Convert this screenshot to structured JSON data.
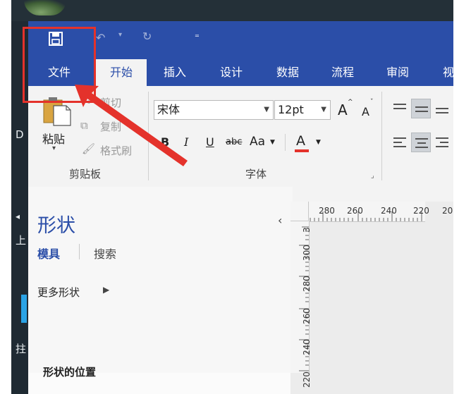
{
  "desktop": {
    "glyphs": [
      "D",
      "上",
      "拄"
    ]
  },
  "quick_access": {
    "save_icon": "save-icon",
    "undo_icon": "undo-icon",
    "redo_icon": "redo-icon",
    "customize_icon": "customize-qat-icon"
  },
  "tabs": [
    {
      "label": "文件"
    },
    {
      "label": "开始"
    },
    {
      "label": "插入"
    },
    {
      "label": "设计"
    },
    {
      "label": "数据"
    },
    {
      "label": "流程"
    },
    {
      "label": "审阅"
    },
    {
      "label": "视"
    }
  ],
  "clipboard": {
    "paste_label": "粘贴",
    "cut_label": "剪切",
    "copy_label": "复制",
    "format_painter_label": "格式刷",
    "group_label": "剪贴板"
  },
  "font": {
    "font_name": "宋体",
    "font_size": "12pt",
    "bold": "B",
    "italic": "I",
    "underline": "U",
    "strikethrough": "abc",
    "change_case": "Aa",
    "font_color": "A",
    "grow": "A",
    "shrink": "A",
    "group_label": "字体"
  },
  "shapes": {
    "title": "形状",
    "tab_stencils": "模具",
    "tab_search": "搜索",
    "more_shapes": "更多形状",
    "shape_location": "形状的位置"
  },
  "ruler": {
    "h_labels": [
      "280",
      "260",
      "240",
      "220",
      "20"
    ],
    "v_labels": [
      "3",
      "300",
      "280",
      "260",
      "240",
      "220"
    ]
  },
  "colors": {
    "title_bar": "#2b4ea8",
    "highlight": "#e4322b",
    "arrow": "#e4322b",
    "font_color_underline": "#e4322b"
  }
}
